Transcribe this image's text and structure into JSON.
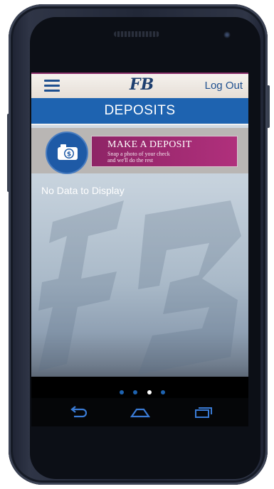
{
  "app": {
    "logo_text": "FB",
    "logout_label": "Log Out",
    "page_title": "DEPOSITS"
  },
  "deposit": {
    "title": "MAKE A DEPOSIT",
    "subtitle_line1": "Snap a photo of your check",
    "subtitle_line2": "and we'll do the rest",
    "icon": "camera-dollar-icon"
  },
  "content": {
    "empty_message": "No Data to Display"
  },
  "pager": {
    "count": 4,
    "active_index": 2
  },
  "system_nav": {
    "buttons": [
      "back-icon",
      "home-icon",
      "recent-apps-icon"
    ]
  },
  "colors": {
    "primary_blue": "#1e63b0",
    "accent_magenta": "#a02a73"
  }
}
